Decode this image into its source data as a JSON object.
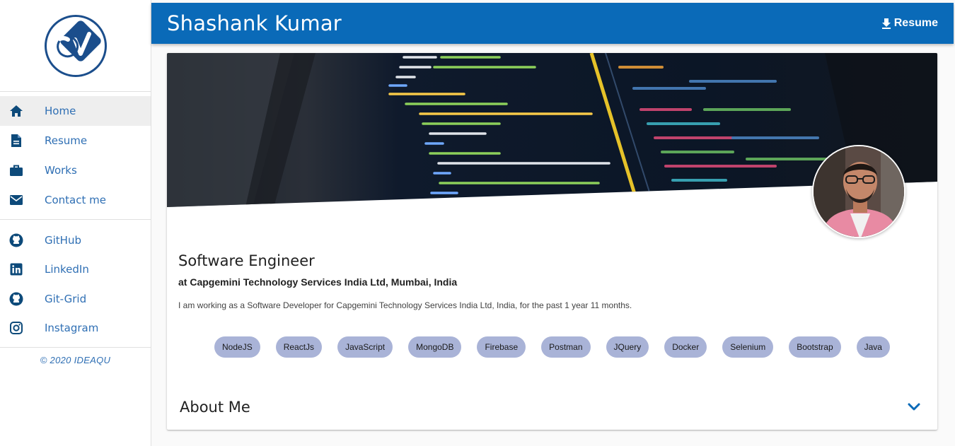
{
  "sidebar": {
    "logo_text": "CV",
    "primary_nav": [
      {
        "label": "Home",
        "icon": "home-icon",
        "active": true
      },
      {
        "label": "Resume",
        "icon": "document-icon",
        "active": false
      },
      {
        "label": "Works",
        "icon": "briefcase-icon",
        "active": false
      },
      {
        "label": "Contact me",
        "icon": "mail-icon",
        "active": false
      }
    ],
    "social_nav": [
      {
        "label": "GitHub",
        "icon": "github-icon"
      },
      {
        "label": "LinkedIn",
        "icon": "linkedin-icon"
      },
      {
        "label": "Git-Grid",
        "icon": "github-icon"
      },
      {
        "label": "Instagram",
        "icon": "instagram-icon"
      }
    ],
    "copyright": "© 2020 IDEAQU"
  },
  "header": {
    "title": "Shashank Kumar",
    "resume_label": "Resume"
  },
  "profile": {
    "job_title": "Software Engineer",
    "company": "at Capgemini Technology Services India Ltd, Mumbai, India",
    "description": "I am working as a Software Developer for Capgemini Technology Services India Ltd, India, for the past 1 year 11 months.",
    "skills": [
      "NodeJS",
      "ReactJs",
      "JavaScript",
      "MongoDB",
      "Firebase",
      "Postman",
      "JQuery",
      "Docker",
      "Selenium",
      "Bootstrap",
      "Java"
    ],
    "about_label": "About Me"
  },
  "colors": {
    "brand": "#0a6ab8",
    "nav_text": "#2f6fb4",
    "chip_bg": "#a9b3d7",
    "icon": "#0d4a7a"
  }
}
